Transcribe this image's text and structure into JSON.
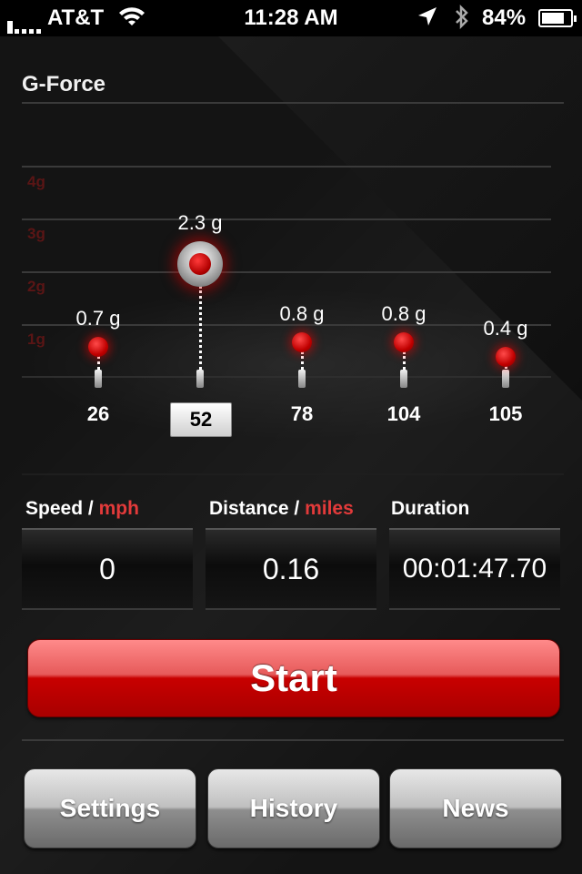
{
  "status_bar": {
    "carrier": "AT&T",
    "time": "11:28 AM",
    "battery_percent": "84%",
    "battery_level": 0.84,
    "icons": [
      "signal-icon",
      "wifi-icon",
      "location-arrow-icon",
      "bluetooth-icon",
      "battery-icon"
    ]
  },
  "screen": {
    "title": "G-Force"
  },
  "chart_data": {
    "type": "scatter",
    "ytick_labels": [
      "4g",
      "3g",
      "2g",
      "1g"
    ],
    "ylim": [
      0,
      4
    ],
    "categories": [
      "26",
      "52",
      "78",
      "104",
      "105"
    ],
    "values": [
      0.7,
      2.3,
      0.8,
      0.8,
      0.4
    ],
    "value_labels": [
      "0.7 g",
      "2.3 g",
      "0.8 g",
      "0.8 g",
      "0.4 g"
    ],
    "selected_index": 1,
    "grid": true,
    "accent_color": "#cc0000"
  },
  "stats": {
    "speed": {
      "label": "Speed",
      "separator": "/",
      "unit": "mph",
      "value": "0"
    },
    "distance": {
      "label": "Distance",
      "separator": "/",
      "unit": "miles",
      "value": "0.16"
    },
    "duration": {
      "label": "Duration",
      "value": "00:01:47.70"
    }
  },
  "start_button": {
    "label": "Start",
    "color": "#c80000"
  },
  "nav": {
    "settings": "Settings",
    "history": "History",
    "news": "News"
  }
}
